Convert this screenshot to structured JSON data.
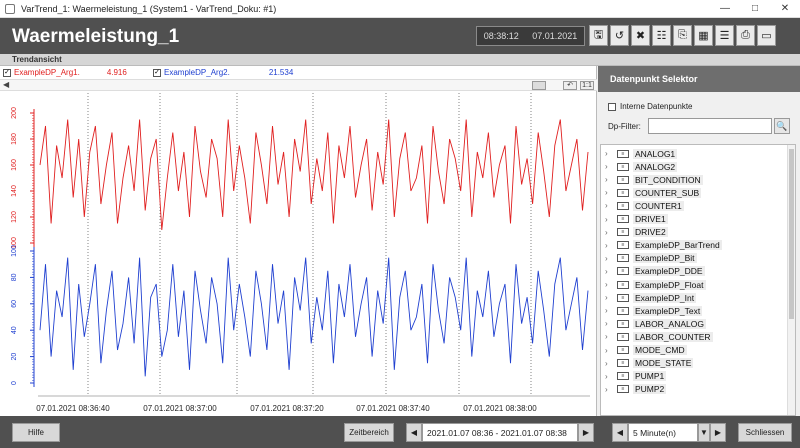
{
  "window": {
    "title": "VarTrend_1: Waermeleistung_1 (System1 - VarTrend_Doku: #1)",
    "minimize_icon": "minimize-icon",
    "maximize_icon": "maximize-icon",
    "close_icon": "close-icon"
  },
  "header": {
    "title": "Waermeleistung_1",
    "time": "08:38:12",
    "date": "07.01.2021",
    "toolbar": [
      "save-icon",
      "refresh-icon",
      "tools-icon",
      "hierarchy-icon",
      "export-icon",
      "settings-icon",
      "list-icon",
      "print-icon",
      "display-icon"
    ]
  },
  "subheader": {
    "label": "Trendansicht"
  },
  "legend": [
    {
      "checked": true,
      "name": "ExampleDP_Arg1.",
      "value": "4.916",
      "color": "#e02020"
    },
    {
      "checked": true,
      "name": "ExampleDP_Arg2.",
      "value": "21.534",
      "color": "#2040d0"
    }
  ],
  "nav": {
    "scale_button": "1:1",
    "undo_icon": "undo-icon"
  },
  "chart_data": {
    "type": "line",
    "x_ticks": [
      "07.01.2021 08:36:40",
      "07.01.2021 08:37:00",
      "07.01.2021 08:37:20",
      "07.01.2021 08:37:40",
      "07.01.2021 08:38:00"
    ],
    "x_range": [
      "07.01.2021 08:36:30",
      "07.01.2021 08:38:10"
    ],
    "series": [
      {
        "name": "ExampleDP_Arg1.",
        "color": "#e02020",
        "axis_ticks": [
          "200",
          "180",
          "160",
          "140",
          "120",
          "100"
        ],
        "axis_range": [
          100,
          200
        ],
        "values": [
          160,
          190,
          115,
          175,
          150,
          195,
          135,
          180,
          120,
          170,
          190,
          130,
          160,
          185,
          115,
          150,
          175,
          140,
          195,
          125,
          165,
          180,
          110,
          150,
          185,
          140,
          170,
          120,
          190,
          155,
          135,
          180,
          165,
          120,
          195,
          140,
          175,
          150,
          115,
          185,
          160,
          130,
          190,
          145,
          170,
          120,
          180,
          155,
          195,
          130,
          165,
          140,
          185,
          115,
          175,
          150,
          190,
          135,
          160,
          180,
          125,
          170,
          145,
          195,
          120,
          165,
          185,
          140,
          150,
          175,
          115,
          190,
          155,
          130,
          180,
          165,
          140,
          195,
          120,
          170,
          150,
          185,
          135,
          160,
          175,
          115,
          190,
          145,
          165,
          130,
          185,
          155,
          120,
          175,
          195,
          140,
          160,
          180,
          125,
          170
        ]
      },
      {
        "name": "ExampleDP_Arg2.",
        "color": "#2040d0",
        "axis_ticks": [
          "100",
          "80",
          "60",
          "40",
          "20",
          "0"
        ],
        "axis_range": [
          0,
          100
        ],
        "values": [
          40,
          90,
          20,
          70,
          50,
          95,
          10,
          75,
          35,
          60,
          90,
          15,
          55,
          85,
          25,
          45,
          80,
          30,
          95,
          5,
          65,
          75,
          20,
          40,
          90,
          35,
          70,
          10,
          85,
          55,
          30,
          80,
          60,
          15,
          95,
          40,
          75,
          50,
          20,
          85,
          60,
          25,
          90,
          45,
          70,
          10,
          80,
          55,
          95,
          30,
          65,
          40,
          85,
          15,
          75,
          50,
          90,
          35,
          60,
          80,
          20,
          70,
          45,
          95,
          10,
          65,
          85,
          40,
          50,
          75,
          15,
          90,
          55,
          30,
          80,
          65,
          40,
          95,
          20,
          70,
          50,
          85,
          35,
          60,
          75,
          15,
          90,
          45,
          65,
          30,
          85,
          55,
          20,
          75,
          95,
          40,
          60,
          80,
          25,
          70
        ]
      }
    ]
  },
  "dp_selector": {
    "title": "Datenpunkt Selektor",
    "intern_label": "Interne Datenpunkte",
    "filter_label": "Dp-Filter:",
    "filter_value": "",
    "items": [
      "ANALOG1",
      "ANALOG2",
      "BIT_CONDITION",
      "COUNTER_SUB",
      "COUNTER1",
      "DRIVE1",
      "DRIVE2",
      "ExampleDP_BarTrend",
      "ExampleDP_Bit",
      "ExampleDP_DDE",
      "ExampleDP_Float",
      "ExampleDP_Int",
      "ExampleDP_Text",
      "LABOR_ANALOG",
      "LABOR_COUNTER",
      "MODE_CMD",
      "MODE_STATE",
      "PUMP1",
      "PUMP2"
    ]
  },
  "footer": {
    "help_label": "Hilfe",
    "zeitbereich_label": "Zeitbereich",
    "range_value": "2021.01.07 08:36 - 2021.01.07 08:38",
    "interval_value": "5 Minute(n)",
    "close_label": "Schliessen"
  }
}
